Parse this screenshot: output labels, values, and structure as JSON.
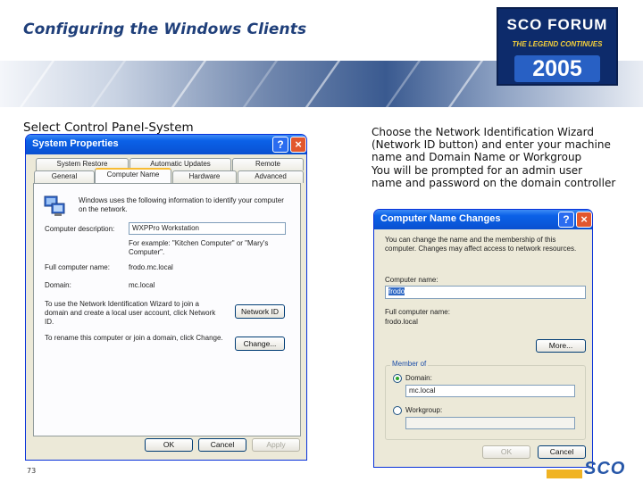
{
  "slide": {
    "title": "Configuring the Windows Clients",
    "caption_left": "Select Control Panel-System",
    "caption_right_lines": [
      "Choose the Network Identification Wizard",
      "(Network ID button) and enter your machine",
      "name and Domain Name or Workgroup",
      "You will be prompted for an admin user",
      "name and password on the domain controller"
    ],
    "page_number": "73",
    "footer_logo": "SCO"
  },
  "logo": {
    "line1": "SCO FORUM",
    "line2": "THE LEGEND CONTINUES",
    "line3": "2005",
    "colors": {
      "navy": "#0d2b6b",
      "gold": "#f4cf3a",
      "blue": "#2860c4"
    }
  },
  "system_properties": {
    "title": "System Properties",
    "help_label": "?",
    "close_label": "×",
    "tabs_row1": [
      "System Restore",
      "Automatic Updates",
      "Remote"
    ],
    "tabs_row2": [
      "General",
      "Computer Name",
      "Hardware",
      "Advanced"
    ],
    "active_tab": "Computer Name",
    "intro_text": "Windows uses the following information to identify your computer on the network.",
    "description_label": "Computer description:",
    "description_value": "WXPPro Workstation",
    "example_text": "For example: \"Kitchen Computer\" or \"Mary's Computer\".",
    "full_name_label": "Full computer name:",
    "full_name_value": "frodo.mc.local",
    "domain_label": "Domain:",
    "domain_value": "mc.local",
    "wizard_text": "To use the Network Identification Wizard to join a domain and create a local user account, click Network ID.",
    "network_id_button": "Network ID",
    "rename_text": "To rename this computer or join a domain, click Change.",
    "change_button": "Change...",
    "ok_button": "OK",
    "cancel_button": "Cancel",
    "apply_button": "Apply"
  },
  "computer_name_changes": {
    "title": "Computer Name Changes",
    "help_label": "?",
    "close_label": "×",
    "intro_text": "You can change the name and the membership of this computer. Changes may affect access to network resources.",
    "computer_name_label": "Computer name:",
    "computer_name_value": "frodo",
    "full_name_label": "Full computer name:",
    "full_name_value": "frodo.local",
    "more_button": "More...",
    "member_of_label": "Member of",
    "domain_option": "Domain:",
    "domain_value": "mc.local",
    "workgroup_option": "Workgroup:",
    "workgroup_value": "",
    "selected_option": "Domain",
    "ok_button": "OK",
    "cancel_button": "Cancel"
  },
  "colors": {
    "title_blue": "#1f3f7a",
    "xp_titlebar": "#0a58db",
    "xp_face": "#ece9d8"
  }
}
